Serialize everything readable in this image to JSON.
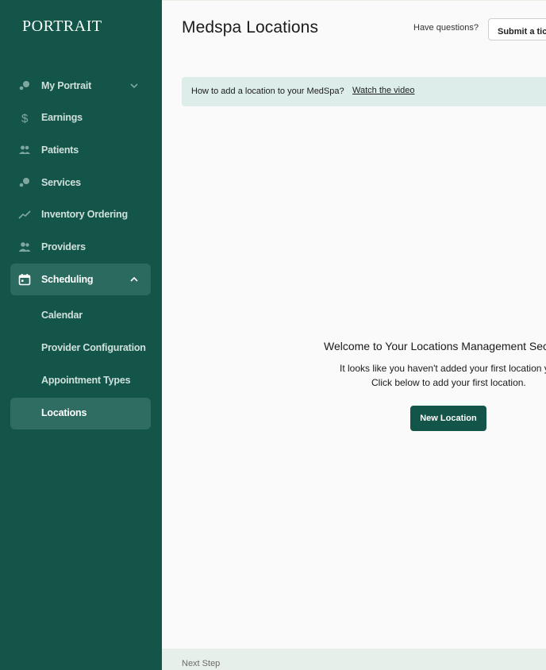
{
  "sidebar": {
    "brand": "PORTRAIT",
    "items": [
      {
        "label": "My Portrait",
        "icon": "molecule-icon"
      },
      {
        "label": "Earnings",
        "icon": "dollar-icon"
      },
      {
        "label": "Patients",
        "icon": "people-icon"
      },
      {
        "label": "Services",
        "icon": "molecule-icon"
      },
      {
        "label": "Inventory Ordering",
        "icon": "trend-icon"
      },
      {
        "label": "Providers",
        "icon": "people-icon"
      },
      {
        "label": "Scheduling",
        "icon": "calendar-icon"
      }
    ],
    "scheduling_sub": [
      {
        "label": "Calendar"
      },
      {
        "label": "Provider Configuration"
      },
      {
        "label": "Appointment Types"
      },
      {
        "label": "Locations"
      }
    ]
  },
  "header": {
    "title": "Medspa Locations",
    "questions": "Have questions?",
    "ticket_button": "Submit a ticket"
  },
  "banner": {
    "text": "How to add a location to your MedSpa?",
    "link": "Watch the video"
  },
  "empty_state": {
    "heading": "Welcome to Your Locations Management Section",
    "line1": "It looks like you haven't added your first location yet.",
    "line2": "Click below to add your first location.",
    "button": "New Location"
  },
  "footer": {
    "text": "Next Step"
  },
  "colors": {
    "sidebar_bg": "#14554a",
    "accent": "#14554a",
    "banner_bg": "#dcedea"
  }
}
